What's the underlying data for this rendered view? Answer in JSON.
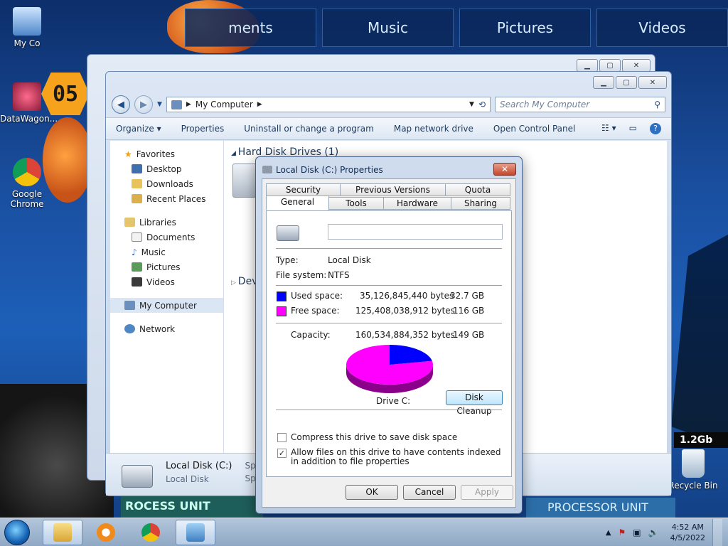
{
  "desktop": {
    "media_tabs": [
      "ments",
      "Music",
      "Pictures",
      "Videos"
    ],
    "badge": "05",
    "speed_label": "1.2Gb",
    "processor_label_left": "ROCESS UNIT",
    "processor_label_right": "PROCESSOR UNIT",
    "icons": {
      "my_computer": "My Co",
      "datawagon": "DataWagon...",
      "chrome": "Google Chrome",
      "recycle_bin": "Recycle Bin"
    }
  },
  "explorer": {
    "address": "My Computer",
    "search_placeholder": "Search My Computer",
    "toolbar": {
      "organize": "Organize",
      "properties": "Properties",
      "uninstall": "Uninstall or change a program",
      "map_drive": "Map network drive",
      "control_panel": "Open Control Panel"
    },
    "nav": {
      "favorites": "Favorites",
      "desktop": "Desktop",
      "downloads": "Downloads",
      "recent_places": "Recent Places",
      "libraries": "Libraries",
      "documents": "Documents",
      "music": "Music",
      "pictures": "Pictures",
      "videos": "Videos",
      "my_computer": "My Computer",
      "network": "Network"
    },
    "group_hard_disks": "Hard Disk Drives (1)",
    "group_devices": "Devi",
    "details": {
      "name": "Local Disk (C:)",
      "type": "Local Disk",
      "space_used_label": "Space u",
      "space_free_label": "Space"
    }
  },
  "dialog": {
    "title": "Local Disk (C:) Properties",
    "tabs_row1": [
      "Security",
      "Previous Versions",
      "Quota"
    ],
    "tabs_row2": [
      "General",
      "Tools",
      "Hardware",
      "Sharing"
    ],
    "active_tab": "General",
    "type_label": "Type:",
    "type_value": "Local Disk",
    "fs_label": "File system:",
    "fs_value": "NTFS",
    "used_label": "Used space:",
    "used_bytes": "35,126,845,440 bytes",
    "used_size": "32.7 GB",
    "free_label": "Free space:",
    "free_bytes": "125,408,038,912 bytes",
    "free_size": "116 GB",
    "capacity_label": "Capacity:",
    "capacity_bytes": "160,534,884,352 bytes",
    "capacity_size": "149 GB",
    "drive_label": "Drive C:",
    "cleanup_button": "Disk Cleanup",
    "compress_label": "Compress this drive to save disk space",
    "index_label": "Allow files on this drive to have contents indexed in addition to file properties",
    "compress_checked": false,
    "index_checked": true,
    "ok": "OK",
    "cancel": "Cancel",
    "apply": "Apply",
    "used_fraction": 0.219,
    "used_color": "#0000ff",
    "free_color": "#ff00ff"
  },
  "taskbar": {
    "time": "4:52 AM",
    "date": "4/5/2022"
  }
}
